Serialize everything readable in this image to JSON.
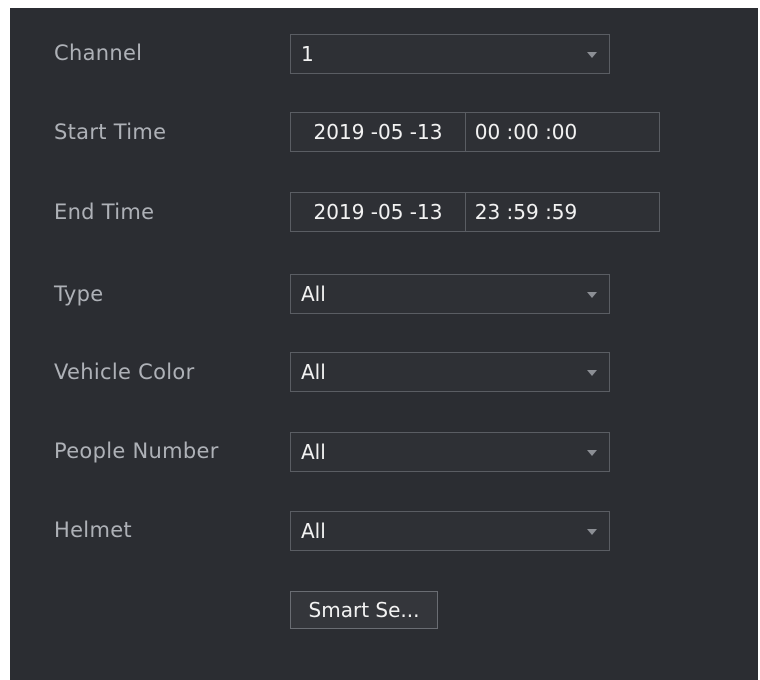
{
  "form": {
    "channel": {
      "label": "Channel",
      "value": "1"
    },
    "start_time": {
      "label": "Start Time",
      "date": "2019 -05 -13",
      "time": "00 :00 :00"
    },
    "end_time": {
      "label": "End Time",
      "date": "2019 -05 -13",
      "time": "23 :59 :59"
    },
    "type": {
      "label": "Type",
      "value": "All"
    },
    "vehicle_color": {
      "label": "Vehicle Color",
      "value": "All"
    },
    "people_number": {
      "label": "People Number",
      "value": "All"
    },
    "helmet": {
      "label": "Helmet",
      "value": "All"
    },
    "smart_search_label": "Smart Se..."
  },
  "icons": {
    "dropdown": "chevron-down-icon"
  },
  "colors": {
    "background": "#2b2d32",
    "label_text": "#aeb1b7",
    "value_text": "#f2f2f2",
    "border": "#5a5d63"
  }
}
